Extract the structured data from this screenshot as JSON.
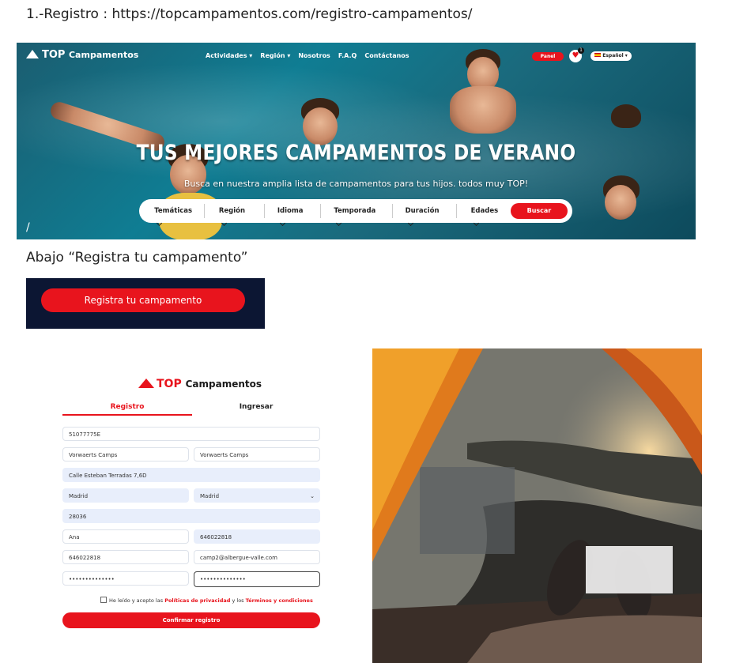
{
  "doc": {
    "step_line": "1.-Registro : https://topcampamentos.com/registro-campamentos/",
    "slash_mark": "/",
    "below_line": "Abajo “Registra tu campamento”"
  },
  "hero": {
    "logo": {
      "top": "TOP",
      "rest": "Campamentos"
    },
    "nav": [
      "Actividades ▾",
      "Región ▾",
      "Nosotros",
      "F.A.Q",
      "Contáctanos"
    ],
    "panel_label": "Panel",
    "heart_count": "1",
    "language": "Español",
    "title": "TUS MEJORES CAMPAMENTOS DE VERANO",
    "subtitle": "Busca en nuestra amplia lista de campamentos para tus hijos. todos muy TOP!",
    "filters": [
      "Temáticas",
      "Región",
      "Idioma",
      "Temporada",
      "Duración",
      "Edades"
    ],
    "search_button": "Buscar"
  },
  "register_cta": {
    "label": "Registra tu campamento"
  },
  "form": {
    "logo": {
      "top": "TOP",
      "rest": "Campamentos"
    },
    "tabs": {
      "registro": "Registro",
      "ingresar": "Ingresar"
    },
    "fields": {
      "nif": "51077775E",
      "camp_name": "Vorwaerts Camps",
      "company_name": "Vorwaerts Camps",
      "address": "Calle Esteban Terradas 7,6D",
      "city": "Madrid",
      "province": "Madrid",
      "postal_code": "28036",
      "contact_name": "Ana",
      "phone_1": "646022818",
      "phone_2": "646022818",
      "email": "camp2@albergue-valle.com",
      "password": "••••••••••••••",
      "password_confirm": "••••••••••••••"
    },
    "consent": {
      "prefix": "He leído y acepto las",
      "privacy": "Políticas de privacidad",
      "middle": "y los",
      "terms": "Términos y condiciones"
    },
    "confirm_button": "Confirmar registro"
  },
  "colors": {
    "accent": "#e8141d",
    "dark_navy": "#0c1633",
    "field_blue": "#e8eefb"
  }
}
